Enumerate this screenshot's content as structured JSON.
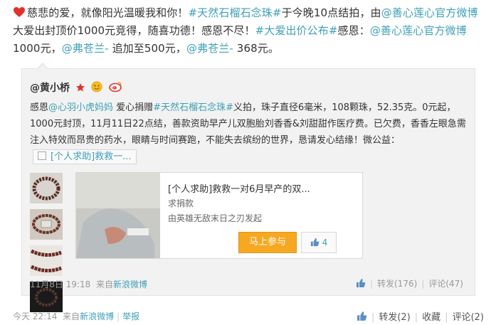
{
  "post": {
    "t1": "慈悲的爱，就像阳光温暖我和你！",
    "tag1": "#天然石榴石念珠#",
    "t2": "于今晚10点结拍，由",
    "at1": "@善心莲心官方微博",
    "t3": " 大爱出封顶价1000元竞得，随喜功德！感恩不尽！",
    "tag2": "#大爱出价公布#",
    "t4": "感恩：",
    "at2": "@善心莲心官方微博",
    "t5": " 1000元，",
    "at3": "@弗苍兰-",
    "t6": " 追加至500元，",
    "at4": "@弗苍兰-",
    "t7": " 368元。"
  },
  "repost": {
    "author": "@黄小桥",
    "r1": "感恩",
    "at1": "@心羽小虎妈妈",
    "r2": " 爱心捐赠",
    "tag": "#天然石榴石念珠#",
    "r3": "义拍，珠子直径6毫米，108颗珠，52.35克。0元起，1000元封顶，11月11日22点结，善款资助早产儿双胞胎刘香香&刘甜甜作医疗费。已欠费，香香左眼急需注入特效而昂贵的药水，眼睛与时间赛跑，不能失去缤纷的世界，恳请发心结缘！微公益：",
    "link_chip": "[个人求助]救救一...",
    "card": {
      "title": "[个人求助]救救一对6月早产的双...",
      "subtitle": "求捐款",
      "by": "由英雄无敌末日之刃发起",
      "join": "马上参与",
      "likes": "4"
    },
    "date": "11月8日 19:18",
    "from_label": "来自",
    "source": "新浪微博",
    "forward": "转发(176)",
    "comment": "评论(47)"
  },
  "footer": {
    "time": "今天 22:14",
    "from_label": "来自",
    "source": "新浪微博",
    "report": "举报",
    "forward": "转发(2)",
    "favorite": "收藏",
    "comment": "评论(2)"
  },
  "colors": {
    "link": "#3fa0b6",
    "button": "#f6a821"
  }
}
